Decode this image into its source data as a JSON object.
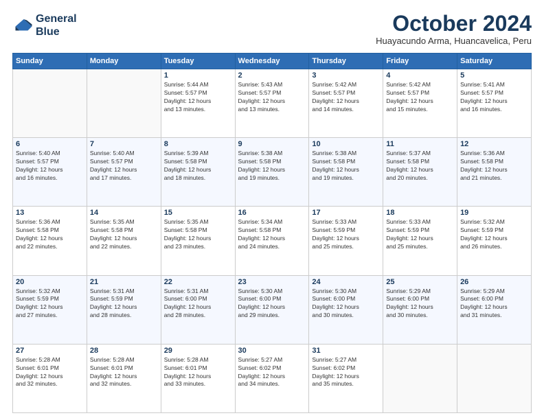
{
  "header": {
    "logo_line1": "General",
    "logo_line2": "Blue",
    "month": "October 2024",
    "location": "Huayacundo Arma, Huancavelica, Peru"
  },
  "weekdays": [
    "Sunday",
    "Monday",
    "Tuesday",
    "Wednesday",
    "Thursday",
    "Friday",
    "Saturday"
  ],
  "weeks": [
    [
      {
        "day": "",
        "sunrise": "",
        "sunset": "",
        "daylight": ""
      },
      {
        "day": "",
        "sunrise": "",
        "sunset": "",
        "daylight": ""
      },
      {
        "day": "1",
        "sunrise": "Sunrise: 5:44 AM",
        "sunset": "Sunset: 5:57 PM",
        "daylight": "Daylight: 12 hours and 13 minutes."
      },
      {
        "day": "2",
        "sunrise": "Sunrise: 5:43 AM",
        "sunset": "Sunset: 5:57 PM",
        "daylight": "Daylight: 12 hours and 13 minutes."
      },
      {
        "day": "3",
        "sunrise": "Sunrise: 5:42 AM",
        "sunset": "Sunset: 5:57 PM",
        "daylight": "Daylight: 12 hours and 14 minutes."
      },
      {
        "day": "4",
        "sunrise": "Sunrise: 5:42 AM",
        "sunset": "Sunset: 5:57 PM",
        "daylight": "Daylight: 12 hours and 15 minutes."
      },
      {
        "day": "5",
        "sunrise": "Sunrise: 5:41 AM",
        "sunset": "Sunset: 5:57 PM",
        "daylight": "Daylight: 12 hours and 16 minutes."
      }
    ],
    [
      {
        "day": "6",
        "sunrise": "Sunrise: 5:40 AM",
        "sunset": "Sunset: 5:57 PM",
        "daylight": "Daylight: 12 hours and 16 minutes."
      },
      {
        "day": "7",
        "sunrise": "Sunrise: 5:40 AM",
        "sunset": "Sunset: 5:57 PM",
        "daylight": "Daylight: 12 hours and 17 minutes."
      },
      {
        "day": "8",
        "sunrise": "Sunrise: 5:39 AM",
        "sunset": "Sunset: 5:58 PM",
        "daylight": "Daylight: 12 hours and 18 minutes."
      },
      {
        "day": "9",
        "sunrise": "Sunrise: 5:38 AM",
        "sunset": "Sunset: 5:58 PM",
        "daylight": "Daylight: 12 hours and 19 minutes."
      },
      {
        "day": "10",
        "sunrise": "Sunrise: 5:38 AM",
        "sunset": "Sunset: 5:58 PM",
        "daylight": "Daylight: 12 hours and 19 minutes."
      },
      {
        "day": "11",
        "sunrise": "Sunrise: 5:37 AM",
        "sunset": "Sunset: 5:58 PM",
        "daylight": "Daylight: 12 hours and 20 minutes."
      },
      {
        "day": "12",
        "sunrise": "Sunrise: 5:36 AM",
        "sunset": "Sunset: 5:58 PM",
        "daylight": "Daylight: 12 hours and 21 minutes."
      }
    ],
    [
      {
        "day": "13",
        "sunrise": "Sunrise: 5:36 AM",
        "sunset": "Sunset: 5:58 PM",
        "daylight": "Daylight: 12 hours and 22 minutes."
      },
      {
        "day": "14",
        "sunrise": "Sunrise: 5:35 AM",
        "sunset": "Sunset: 5:58 PM",
        "daylight": "Daylight: 12 hours and 22 minutes."
      },
      {
        "day": "15",
        "sunrise": "Sunrise: 5:35 AM",
        "sunset": "Sunset: 5:58 PM",
        "daylight": "Daylight: 12 hours and 23 minutes."
      },
      {
        "day": "16",
        "sunrise": "Sunrise: 5:34 AM",
        "sunset": "Sunset: 5:58 PM",
        "daylight": "Daylight: 12 hours and 24 minutes."
      },
      {
        "day": "17",
        "sunrise": "Sunrise: 5:33 AM",
        "sunset": "Sunset: 5:59 PM",
        "daylight": "Daylight: 12 hours and 25 minutes."
      },
      {
        "day": "18",
        "sunrise": "Sunrise: 5:33 AM",
        "sunset": "Sunset: 5:59 PM",
        "daylight": "Daylight: 12 hours and 25 minutes."
      },
      {
        "day": "19",
        "sunrise": "Sunrise: 5:32 AM",
        "sunset": "Sunset: 5:59 PM",
        "daylight": "Daylight: 12 hours and 26 minutes."
      }
    ],
    [
      {
        "day": "20",
        "sunrise": "Sunrise: 5:32 AM",
        "sunset": "Sunset: 5:59 PM",
        "daylight": "Daylight: 12 hours and 27 minutes."
      },
      {
        "day": "21",
        "sunrise": "Sunrise: 5:31 AM",
        "sunset": "Sunset: 5:59 PM",
        "daylight": "Daylight: 12 hours and 28 minutes."
      },
      {
        "day": "22",
        "sunrise": "Sunrise: 5:31 AM",
        "sunset": "Sunset: 6:00 PM",
        "daylight": "Daylight: 12 hours and 28 minutes."
      },
      {
        "day": "23",
        "sunrise": "Sunrise: 5:30 AM",
        "sunset": "Sunset: 6:00 PM",
        "daylight": "Daylight: 12 hours and 29 minutes."
      },
      {
        "day": "24",
        "sunrise": "Sunrise: 5:30 AM",
        "sunset": "Sunset: 6:00 PM",
        "daylight": "Daylight: 12 hours and 30 minutes."
      },
      {
        "day": "25",
        "sunrise": "Sunrise: 5:29 AM",
        "sunset": "Sunset: 6:00 PM",
        "daylight": "Daylight: 12 hours and 30 minutes."
      },
      {
        "day": "26",
        "sunrise": "Sunrise: 5:29 AM",
        "sunset": "Sunset: 6:00 PM",
        "daylight": "Daylight: 12 hours and 31 minutes."
      }
    ],
    [
      {
        "day": "27",
        "sunrise": "Sunrise: 5:28 AM",
        "sunset": "Sunset: 6:01 PM",
        "daylight": "Daylight: 12 hours and 32 minutes."
      },
      {
        "day": "28",
        "sunrise": "Sunrise: 5:28 AM",
        "sunset": "Sunset: 6:01 PM",
        "daylight": "Daylight: 12 hours and 32 minutes."
      },
      {
        "day": "29",
        "sunrise": "Sunrise: 5:28 AM",
        "sunset": "Sunset: 6:01 PM",
        "daylight": "Daylight: 12 hours and 33 minutes."
      },
      {
        "day": "30",
        "sunrise": "Sunrise: 5:27 AM",
        "sunset": "Sunset: 6:02 PM",
        "daylight": "Daylight: 12 hours and 34 minutes."
      },
      {
        "day": "31",
        "sunrise": "Sunrise: 5:27 AM",
        "sunset": "Sunset: 6:02 PM",
        "daylight": "Daylight: 12 hours and 35 minutes."
      },
      {
        "day": "",
        "sunrise": "",
        "sunset": "",
        "daylight": ""
      },
      {
        "day": "",
        "sunrise": "",
        "sunset": "",
        "daylight": ""
      }
    ]
  ]
}
